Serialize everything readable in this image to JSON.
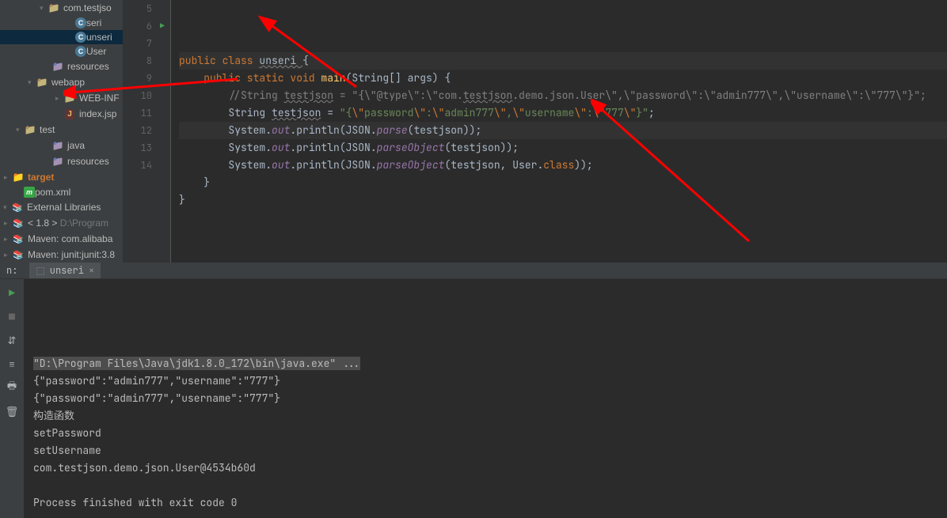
{
  "sidebar": {
    "items": [
      {
        "label": "com.testjso",
        "icon": "folder",
        "indent": "ind1",
        "arrow": "down"
      },
      {
        "label": "seri",
        "icon": "class",
        "indent": "ind3"
      },
      {
        "label": "unseri",
        "icon": "class",
        "indent": "ind3",
        "selected": true
      },
      {
        "label": "User",
        "icon": "class",
        "indent": "ind3"
      },
      {
        "label": "resources",
        "icon": "folder-src",
        "indent": "ind-c"
      },
      {
        "label": "webapp",
        "icon": "folder",
        "indent": "ind-b",
        "arrow": "down"
      },
      {
        "label": "WEB-INF",
        "icon": "folder",
        "indent": "ind2",
        "arrow": "right"
      },
      {
        "label": "index.jsp",
        "icon": "jsp",
        "indent": "ind2"
      },
      {
        "label": "test",
        "icon": "folder",
        "indent": "ind-d",
        "arrow": "down"
      },
      {
        "label": "java",
        "icon": "folder-src",
        "indent": "ind-c"
      },
      {
        "label": "resources",
        "icon": "folder-src",
        "indent": "ind-c"
      },
      {
        "label": "target",
        "icon": "target",
        "indent": "ind-e",
        "arrow": "right",
        "excluded": true
      },
      {
        "label": "pom.xml",
        "icon": "m",
        "indent": "ind-d"
      },
      {
        "label": "External Libraries",
        "icon": "lib",
        "indent": "ind-0",
        "arrow": "down"
      },
      {
        "label": "< 1.8 >",
        "suffix": " D:\\Program",
        "icon": "lib-jdk",
        "indent": "ind-e",
        "arrow": "right"
      },
      {
        "label": "Maven: com.alibaba",
        "icon": "lib-jdk",
        "indent": "ind-e",
        "arrow": "right"
      },
      {
        "label": "Maven: junit:junit:3.8",
        "icon": "lib-jdk",
        "indent": "ind-e",
        "arrow": "right"
      }
    ]
  },
  "editor": {
    "first_line_no": 5,
    "lines": [
      {
        "n": 5,
        "tokens": [
          {
            "t": "public ",
            "c": "kw"
          },
          {
            "t": "class ",
            "c": "kw"
          },
          {
            "t": "unseri ",
            "c": "cls wavy"
          },
          {
            "t": "{",
            "c": ""
          }
        ],
        "hl": true
      },
      {
        "n": 6,
        "run": true,
        "tokens": [
          {
            "t": "    ",
            "c": ""
          },
          {
            "t": "public static void ",
            "c": "kw"
          },
          {
            "t": "main",
            "c": "method"
          },
          {
            "t": "(String[] args) {",
            "c": ""
          }
        ]
      },
      {
        "n": 7,
        "tokens": [
          {
            "t": "        ",
            "c": ""
          },
          {
            "t": "//String ",
            "c": "cmt"
          },
          {
            "t": "testjson",
            "c": "cmt wavy"
          },
          {
            "t": " = \"{\\\"@type\\\":\\\"com.",
            "c": "cmt"
          },
          {
            "t": "testjson",
            "c": "cmt wavy"
          },
          {
            "t": ".demo.json.User\\\",\\\"password\\\":\\\"admin777\\\",\\\"username\\\":\\\"777\\\"}\";",
            "c": "cmt"
          }
        ]
      },
      {
        "n": 8,
        "tokens": [
          {
            "t": "        String ",
            "c": ""
          },
          {
            "t": "testjson",
            "c": "wavy"
          },
          {
            "t": " = ",
            "c": ""
          },
          {
            "t": "\"{",
            "c": "str"
          },
          {
            "t": "\\\"",
            "c": "esc"
          },
          {
            "t": "password",
            "c": "str"
          },
          {
            "t": "\\\"",
            "c": "esc"
          },
          {
            "t": ":",
            "c": "str"
          },
          {
            "t": "\\\"",
            "c": "esc"
          },
          {
            "t": "admin777",
            "c": "str"
          },
          {
            "t": "\\\"",
            "c": "esc"
          },
          {
            "t": ",",
            "c": "str"
          },
          {
            "t": "\\\"",
            "c": "esc"
          },
          {
            "t": "username",
            "c": "str"
          },
          {
            "t": "\\\"",
            "c": "esc"
          },
          {
            "t": ":",
            "c": "str"
          },
          {
            "t": "\\\"",
            "c": "esc"
          },
          {
            "t": "777",
            "c": "str"
          },
          {
            "t": "\\\"",
            "c": "esc"
          },
          {
            "t": "}\"",
            "c": "str"
          },
          {
            "t": ";",
            "c": ""
          }
        ]
      },
      {
        "n": 9,
        "hl": true,
        "tokens": [
          {
            "t": "        System.",
            "c": ""
          },
          {
            "t": "out",
            "c": "field"
          },
          {
            "t": ".println(JSON.",
            "c": ""
          },
          {
            "t": "parse",
            "c": "field"
          },
          {
            "t": "(testjson));",
            "c": ""
          }
        ]
      },
      {
        "n": 10,
        "tokens": [
          {
            "t": "        System.",
            "c": ""
          },
          {
            "t": "out",
            "c": "field"
          },
          {
            "t": ".println(JSON.",
            "c": ""
          },
          {
            "t": "parseObject",
            "c": "field"
          },
          {
            "t": "(testjson));",
            "c": ""
          }
        ]
      },
      {
        "n": 11,
        "tokens": [
          {
            "t": "        System.",
            "c": ""
          },
          {
            "t": "out",
            "c": "field"
          },
          {
            "t": ".println(JSON.",
            "c": ""
          },
          {
            "t": "parseObject",
            "c": "field"
          },
          {
            "t": "(testjson, User.",
            "c": ""
          },
          {
            "t": "class",
            "c": "kw"
          },
          {
            "t": "));",
            "c": ""
          }
        ]
      },
      {
        "n": 12,
        "tokens": [
          {
            "t": "    }",
            "c": ""
          }
        ]
      },
      {
        "n": 13,
        "tokens": [
          {
            "t": "}",
            "c": ""
          }
        ]
      },
      {
        "n": 14,
        "tokens": [
          {
            "t": "",
            "c": ""
          }
        ]
      }
    ]
  },
  "run_tab": {
    "prefix": "n:",
    "label": "unseri"
  },
  "console": {
    "lines": [
      {
        "text": "\"D:\\Program Files\\Java\\jdk1.8.0_172\\bin\\java.exe\" ...",
        "cmd": true
      },
      {
        "text": "{\"password\":\"admin777\",\"username\":\"777\"}"
      },
      {
        "text": "{\"password\":\"admin777\",\"username\":\"777\"}"
      },
      {
        "text": "构造函数"
      },
      {
        "text": "setPassword"
      },
      {
        "text": "setUsername"
      },
      {
        "text": "com.testjson.demo.json.User@4534b60d"
      },
      {
        "text": ""
      },
      {
        "text": "Process finished with exit code 0"
      }
    ]
  }
}
